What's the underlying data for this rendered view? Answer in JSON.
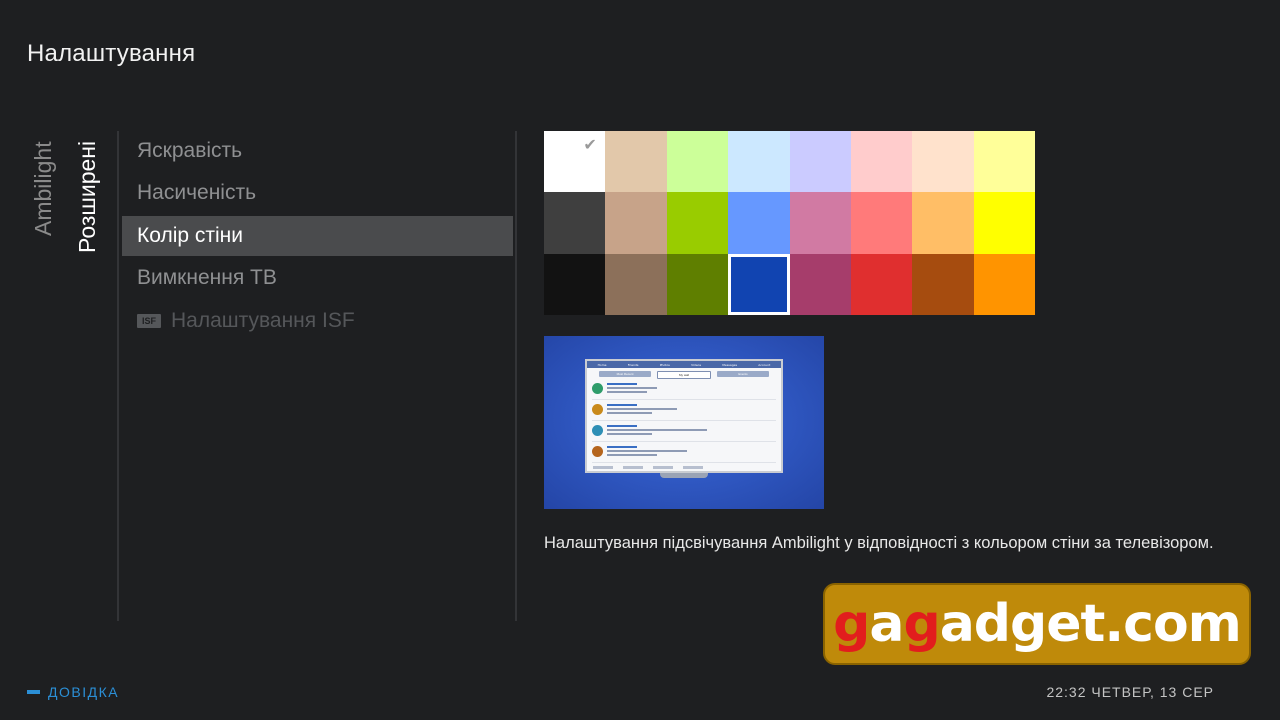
{
  "page_title": "Налаштування",
  "side_tabs": {
    "ambilight": "Ambilight",
    "advanced": "Розширені"
  },
  "menu": {
    "items": [
      {
        "label": "Яскравість"
      },
      {
        "label": "Насиченість"
      },
      {
        "label": "Колір стіни"
      },
      {
        "label": "Вимкнення ТВ"
      },
      {
        "label": "Налаштування ISF",
        "badge": "ISF"
      }
    ],
    "selected_index": 2
  },
  "palette": {
    "colors": [
      "#ffffff",
      "#e2c8aa",
      "#ccff99",
      "#cce8ff",
      "#cbcbff",
      "#ffcccc",
      "#ffe2cc",
      "#ffff99",
      "#3f3f3f",
      "#c7a389",
      "#99cc00",
      "#6698ff",
      "#d17aa3",
      "#ff7a7a",
      "#ffbe66",
      "#ffff00",
      "#121212",
      "#8c705a",
      "#5f7f00",
      "#1144b1",
      "#a63d6b",
      "#e02f2f",
      "#a64c0f",
      "#ff9400"
    ],
    "checked_index": 0,
    "selected_index": 19
  },
  "preview": {
    "nav": [
      "Home",
      "Friends",
      "Photos",
      "Videos",
      "Messages",
      "Account"
    ],
    "tabs": [
      "Most Recent",
      "My wall",
      "Events"
    ]
  },
  "description": "Налаштування підсвічування Ambilight у відповідності з кольором стіни за телевізором.",
  "watermark": {
    "part1": "g",
    "part2": "a",
    "part3": "g",
    "part4": "adget.com"
  },
  "help_label": "ДОВІДКА",
  "clock": "22:32 ЧЕТВЕР, 13 СЕР"
}
